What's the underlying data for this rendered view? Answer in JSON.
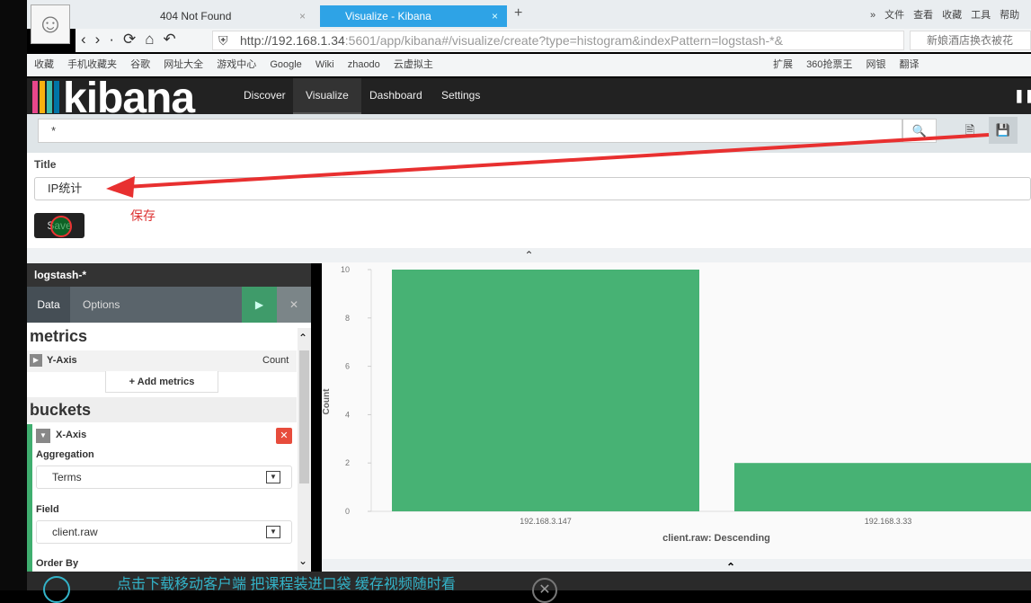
{
  "browser": {
    "tabs": [
      {
        "label": "404 Not Found"
      },
      {
        "label": "Visualize - Kibana",
        "active": true
      }
    ],
    "url_host": "http://192.168.1.34",
    "url_rest": ":5601/app/kibana#/visualize/create?type=histogram&indexPattern=logstash-*&",
    "search_placeholder": "新娘酒店换衣被花",
    "menu": [
      "文件",
      "查看",
      "收藏",
      "工具",
      "帮助"
    ],
    "bookmarks": [
      "收藏",
      "手机收藏夹",
      "谷歌",
      "网址大全",
      "游戏中心",
      "Google",
      "Wiki",
      "zhaodo",
      "云虚拟主"
    ],
    "bookmarks_right": [
      "扩展",
      "360抢票王",
      "网银",
      "翻译"
    ]
  },
  "kibana": {
    "logo": "kibana",
    "logo_colors": [
      "#e8478b",
      "#f9b110",
      "#3ebeb0",
      "#0074a6"
    ],
    "nav": [
      "Discover",
      "Visualize",
      "Dashboard",
      "Settings"
    ],
    "query": "*",
    "title_label": "Title",
    "title_value": "IP统计",
    "annotation": "保存",
    "save_label": "Save",
    "sidebar": {
      "index": "logstash-*",
      "tabs": [
        "Data",
        "Options"
      ],
      "metrics_heading": "metrics",
      "y_axis": "Y-Axis",
      "y_agg": "Count",
      "add_metrics": "Add metrics",
      "buckets_heading": "buckets",
      "x_axis": "X-Axis",
      "aggregation_label": "Aggregation",
      "aggregation_value": "Terms",
      "field_label": "Field",
      "field_value": "client.raw",
      "order_by_label": "Order By"
    }
  },
  "chart_data": {
    "type": "bar",
    "categories": [
      "192.168.3.147",
      "192.168.3.33"
    ],
    "values": [
      10,
      2
    ],
    "xlabel": "client.raw: Descending",
    "ylabel": "Count",
    "ylim": [
      0,
      10
    ],
    "yticks": [
      "0",
      "2",
      "4",
      "6",
      "8",
      "10"
    ],
    "color": "#47b274"
  },
  "overlay": {
    "text": "点击下载移动客户端 把课程装进口袋 缓存视频随时看"
  }
}
